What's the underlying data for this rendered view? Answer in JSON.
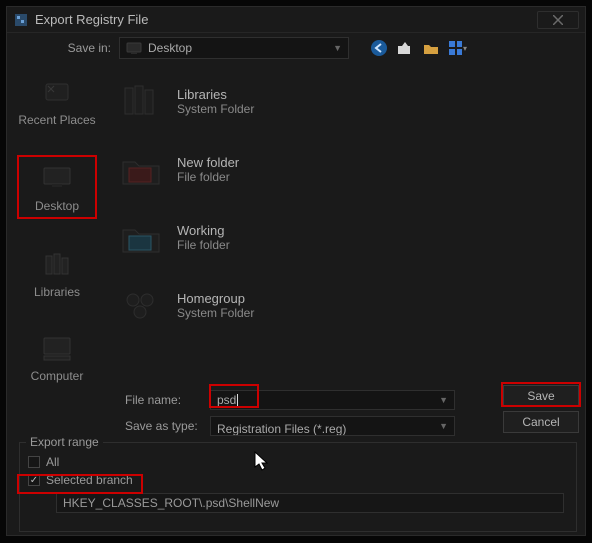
{
  "window": {
    "title": "Export Registry File"
  },
  "save_in": {
    "label": "Save in:",
    "value": "Desktop"
  },
  "sidebar": {
    "items": [
      {
        "label": "Recent Places"
      },
      {
        "label": "Desktop"
      },
      {
        "label": "Libraries"
      },
      {
        "label": "Computer"
      }
    ]
  },
  "files": [
    {
      "name": "Libraries",
      "type": "System Folder"
    },
    {
      "name": "New folder",
      "type": "File folder"
    },
    {
      "name": "Working",
      "type": "File folder"
    },
    {
      "name": "Homegroup",
      "type": "System Folder"
    }
  ],
  "filename": {
    "label": "File name:",
    "value": "psd"
  },
  "filetype": {
    "label": "Save as type:",
    "value": "Registration Files (*.reg)"
  },
  "buttons": {
    "save": "Save",
    "cancel": "Cancel"
  },
  "export_range": {
    "legend": "Export range",
    "all_label": "All",
    "all_checked": false,
    "selected_label": "Selected branch",
    "selected_checked": true,
    "branch_path": "HKEY_CLASSES_ROOT\\.psd\\ShellNew"
  }
}
